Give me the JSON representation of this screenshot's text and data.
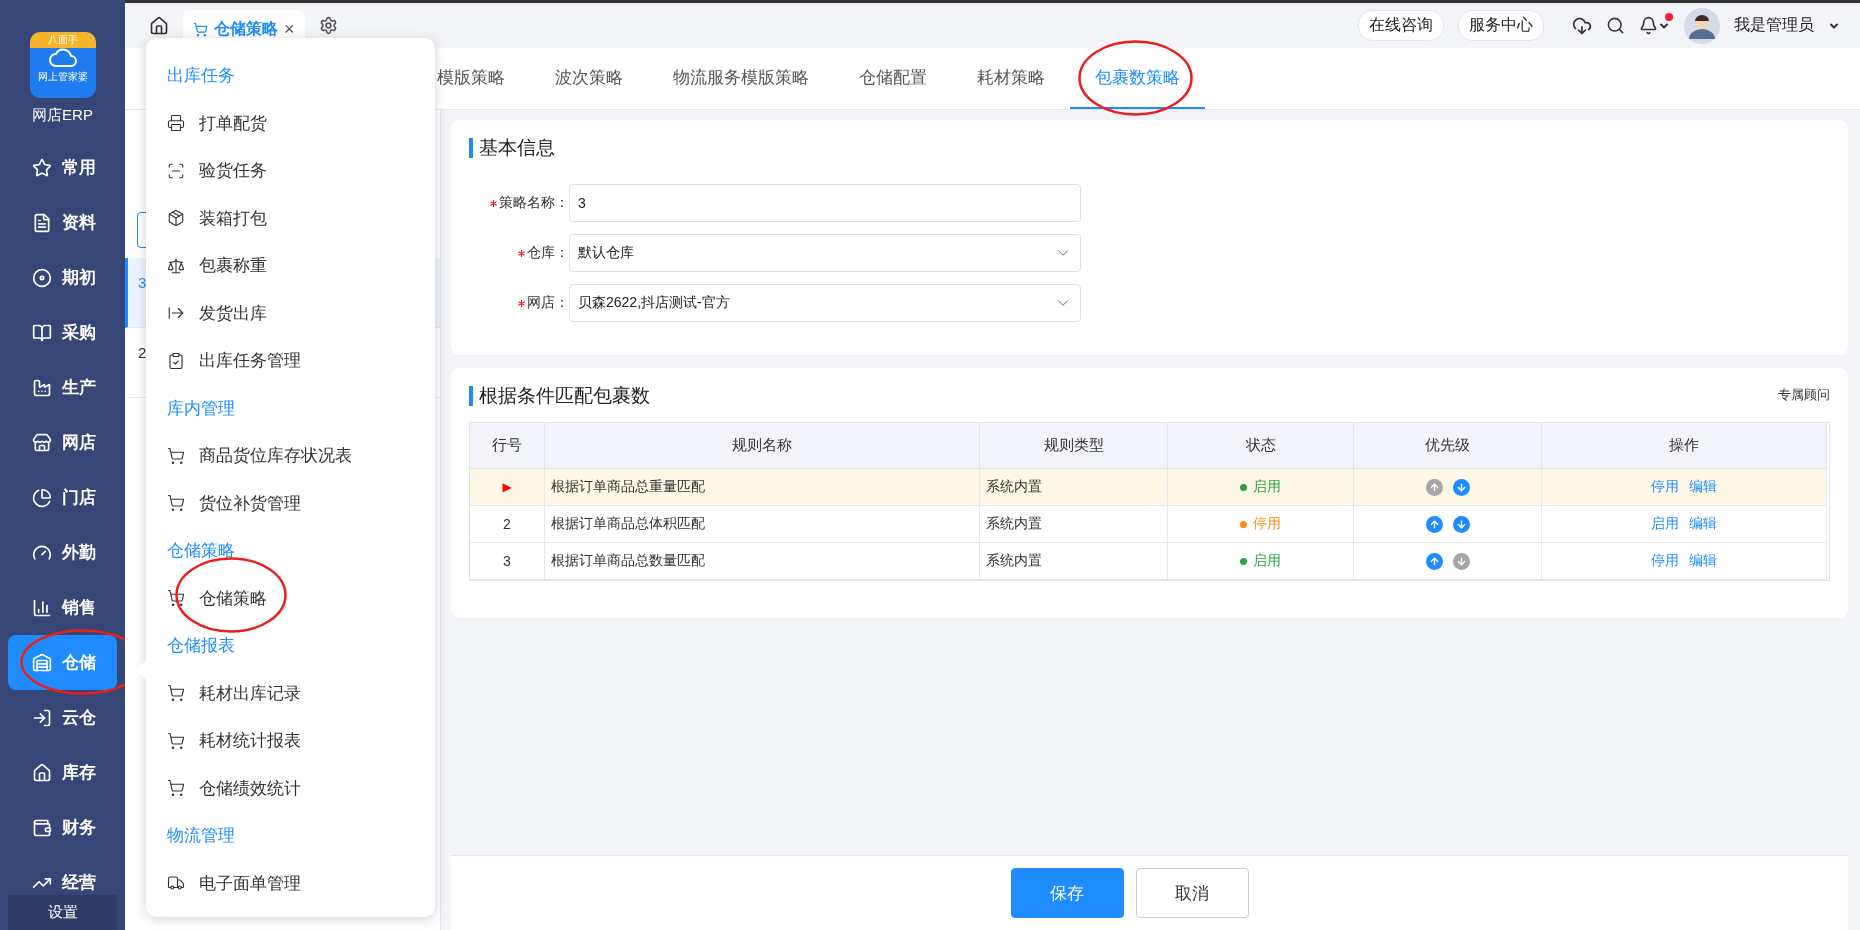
{
  "sidebar": {
    "logo": {
      "badge": "八面手",
      "caption": "网上管家婆"
    },
    "app_name": "网店ERP",
    "items": [
      {
        "label": "常用",
        "kind": "star",
        "selected": false,
        "circled": false
      },
      {
        "label": "资料",
        "kind": "doc",
        "selected": false,
        "circled": false
      },
      {
        "label": "期初",
        "kind": "disc",
        "selected": false,
        "circled": false
      },
      {
        "label": "采购",
        "kind": "book",
        "selected": false,
        "circled": false
      },
      {
        "label": "生产",
        "kind": "factory",
        "selected": false,
        "circled": false
      },
      {
        "label": "网店",
        "kind": "store",
        "selected": false,
        "circled": false
      },
      {
        "label": "门店",
        "kind": "pie",
        "selected": false,
        "circled": false
      },
      {
        "label": "外勤",
        "kind": "gauge",
        "selected": false,
        "circled": false
      },
      {
        "label": "销售",
        "kind": "bars",
        "selected": false,
        "circled": false
      },
      {
        "label": "仓储",
        "kind": "warehouse",
        "selected": true,
        "circled": true
      },
      {
        "label": "云仓",
        "kind": "inbox",
        "selected": false,
        "circled": false
      },
      {
        "label": "库存",
        "kind": "house",
        "selected": false,
        "circled": false
      },
      {
        "label": "财务",
        "kind": "wallet",
        "selected": false,
        "circled": false
      },
      {
        "label": "经营",
        "kind": "trend",
        "selected": false,
        "circled": false
      }
    ],
    "footer": "设置"
  },
  "topbar": {
    "open_tabs": [
      {
        "label": "仓储策略",
        "selected": true,
        "close": "×"
      }
    ],
    "links": [
      "在线咨询",
      "服务中心"
    ],
    "unread": true,
    "user": "我是管理员"
  },
  "tabs": [
    {
      "label": "模版策略",
      "selected": false,
      "circled": false
    },
    {
      "label": "波次策略",
      "selected": false,
      "circled": false
    },
    {
      "label": "物流服务模版策略",
      "selected": false,
      "circled": false
    },
    {
      "label": "仓储配置",
      "selected": false,
      "circled": false
    },
    {
      "label": "耗材策略",
      "selected": false,
      "circled": false
    },
    {
      "label": "包裹数策略",
      "selected": true,
      "circled": true
    }
  ],
  "list_panel": {
    "items": [
      {
        "name": "3",
        "selected": true
      },
      {
        "name": "2",
        "selected": false
      }
    ]
  },
  "basic_info": {
    "title": "基本信息",
    "fields": [
      {
        "label": "策略名称：",
        "required": true,
        "kind": "text",
        "value": "3"
      },
      {
        "label": "仓库：",
        "required": true,
        "kind": "select",
        "value": "默认仓库"
      },
      {
        "label": "网店：",
        "required": true,
        "kind": "select",
        "value": "贝森2622,抖店测试-官方"
      }
    ]
  },
  "rules": {
    "title": "根据条件匹配包裹数",
    "advisor": "专属顾问",
    "columns": [
      "行号",
      "规则名称",
      "规则类型",
      "状态",
      "优先级",
      "操作"
    ],
    "rows": [
      {
        "row_no": "▶",
        "selected": true,
        "name": "根据订单商品总重量匹配",
        "type": "系统内置",
        "status": {
          "label": "启用",
          "color": "#2ba245"
        },
        "up_enabled": false,
        "down_enabled": true,
        "actions": [
          "停用",
          "编辑"
        ]
      },
      {
        "row_no": "2",
        "selected": false,
        "name": "根据订单商品总体积匹配",
        "type": "系统内置",
        "status": {
          "label": "停用",
          "color": "#fa8c16"
        },
        "up_enabled": true,
        "down_enabled": true,
        "actions": [
          "启用",
          "编辑"
        ]
      },
      {
        "row_no": "3",
        "selected": false,
        "name": "根据订单商品总数量匹配",
        "type": "系统内置",
        "status": {
          "label": "启用",
          "color": "#2ba245"
        },
        "up_enabled": true,
        "down_enabled": false,
        "actions": [
          "停用",
          "编辑"
        ]
      }
    ]
  },
  "footer": {
    "buttons": [
      {
        "label": "保存",
        "kind": "primary"
      },
      {
        "label": "取消",
        "kind": "default"
      }
    ]
  },
  "menu": {
    "sections": [
      {
        "title": "出库任务",
        "items": [
          {
            "label": "打单配货",
            "kind": "print",
            "circled": false
          },
          {
            "label": "验货任务",
            "kind": "scan",
            "circled": false
          },
          {
            "label": "装箱打包",
            "kind": "pack",
            "circled": false
          },
          {
            "label": "包裹称重",
            "kind": "weigh",
            "circled": false
          },
          {
            "label": "发货出库",
            "kind": "ship",
            "circled": false
          },
          {
            "label": "出库任务管理",
            "kind": "tasks",
            "circled": false
          }
        ]
      },
      {
        "title": "库内管理",
        "items": [
          {
            "label": "商品货位库存状况表",
            "kind": "cart",
            "circled": false
          },
          {
            "label": "货位补货管理",
            "kind": "cart",
            "circled": false
          }
        ]
      },
      {
        "title": "仓储策略",
        "items": [
          {
            "label": "仓储策略",
            "kind": "cart",
            "circled": true
          }
        ]
      },
      {
        "title": "仓储报表",
        "items": [
          {
            "label": "耗材出库记录",
            "kind": "cart",
            "circled": false
          },
          {
            "label": "耗材统计报表",
            "kind": "cart",
            "circled": false
          },
          {
            "label": "仓储绩效统计",
            "kind": "cart",
            "circled": false
          }
        ]
      },
      {
        "title": "物流管理",
        "items": [
          {
            "label": "电子面单管理",
            "kind": "truck",
            "circled": false
          }
        ]
      }
    ]
  }
}
